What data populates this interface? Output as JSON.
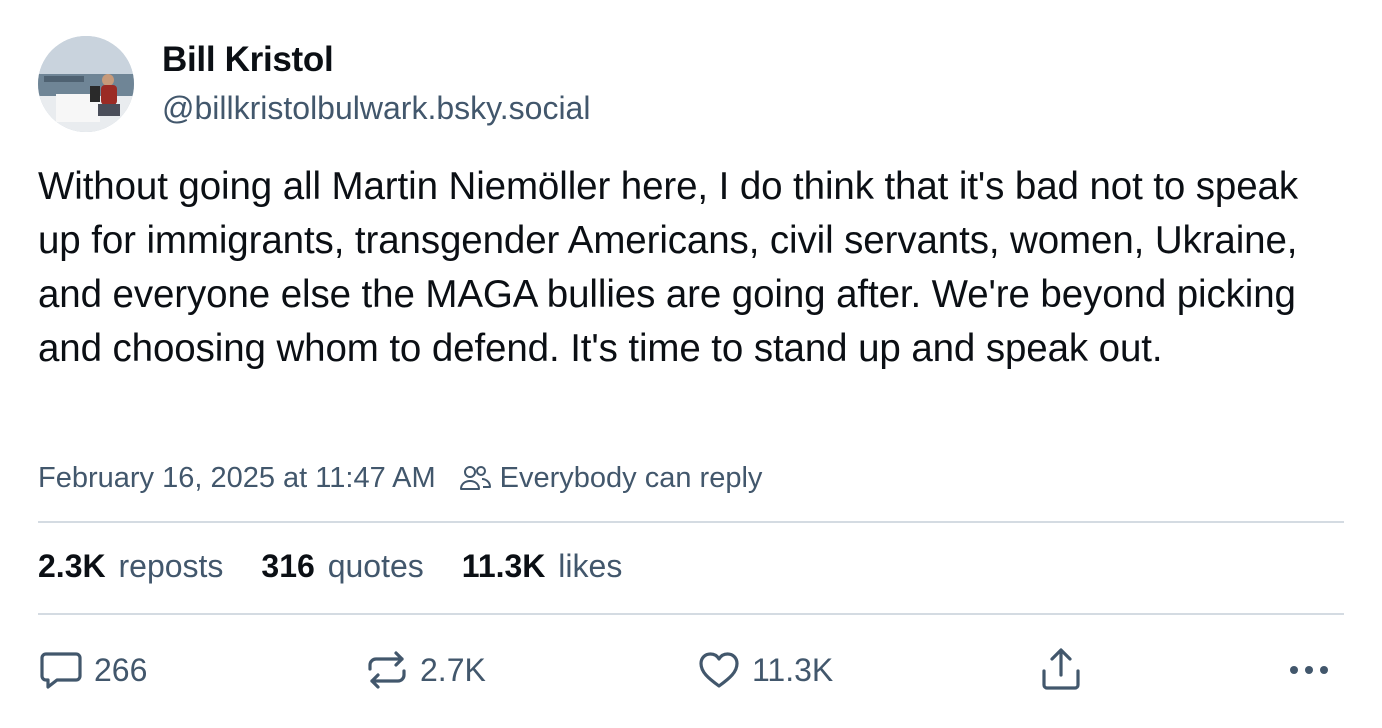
{
  "author": {
    "display_name": "Bill Kristol",
    "handle": "@billkristolbulwark.bsky.social"
  },
  "post": {
    "text": "Without going all Martin Niemöller here, I do think that it's bad not to speak up for immigrants, transgender Americans, civil servants, women, Ukraine, and everyone else the MAGA bullies are going after. We're beyond picking and choosing whom to defend. It's time to stand up and speak out.",
    "timestamp": "February 16, 2025 at 11:47 AM",
    "reply_setting": "Everybody can reply"
  },
  "stats": {
    "reposts_count": "2.3K",
    "reposts_label": "reposts",
    "quotes_count": "316",
    "quotes_label": "quotes",
    "likes_count": "11.3K",
    "likes_label": "likes"
  },
  "actions": {
    "reply_count": "266",
    "repost_count": "2.7K",
    "like_count": "11.3K"
  },
  "icons": {
    "reply": "speech-bubble-icon",
    "repost": "repost-arrows-icon",
    "like": "heart-icon",
    "share": "share-icon",
    "more": "ellipsis-icon",
    "reply_setting": "people-icon"
  },
  "colors": {
    "text": "#0b0f14",
    "muted": "#42576c",
    "divider": "#d4dbe2"
  }
}
